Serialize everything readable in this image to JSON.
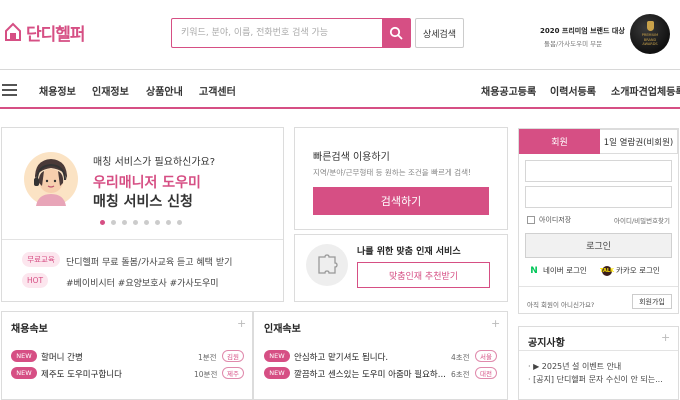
{
  "brand": {
    "name": "단디헬퍼",
    "accent": "#d64f84"
  },
  "search": {
    "placeholder": "키워드, 분야, 이름, 전화번호 검색 가능",
    "advanced_label": "상세검색"
  },
  "award": {
    "title": "2020 프리미엄 브랜드 대상",
    "subtitle": "돌봄/가사도우미 부문",
    "badge_lines": [
      "PREMIUM",
      "BRAND",
      "AWARDS"
    ]
  },
  "nav": {
    "left": [
      "채용정보",
      "인재정보",
      "상품안내",
      "고객센터"
    ],
    "right": [
      "채용공고등록",
      "이력서등록",
      "소개파견업체등록"
    ]
  },
  "banner": {
    "question": "매칭 서비스가 필요하신가요?",
    "title_pink": "우리매니저 도우미",
    "title_dark": "매칭 서비스 신청",
    "dots": 8,
    "active_dot": 0
  },
  "info": [
    {
      "tag": "무료교육",
      "text": "단디헬퍼 무료 돌봄/가사교육 듣고 혜택 받기"
    },
    {
      "tag": "HOT",
      "text": "#베이비시터 #요양보호사 #가사도우미"
    }
  ],
  "quick": {
    "title": "빠른검색 이용하기",
    "subtitle": "지역/분야/근무형태 등 원하는 조건을 빠르게 검색!",
    "button": "검색하기"
  },
  "match": {
    "title": "나를 위한 맞춤 인재 서비스",
    "button": "맞춤인재 추천받기"
  },
  "login": {
    "tab_member": "회원",
    "tab_guest": "1일 열람권(비회원)",
    "save_id": "아이디저장",
    "find": "아이디/비밀번호찾기",
    "login_button": "로그인",
    "naver": "네이버 로그인",
    "kakao": "카카오 로그인",
    "not_member": "아직 회원이 아니신가요?",
    "join": "회원가입"
  },
  "job_news": {
    "title": "채용속보",
    "rows": [
      {
        "badge": "NEW",
        "title": "할머니 간병",
        "time": "1분전",
        "loc": "김원"
      },
      {
        "badge": "NEW",
        "title": "제주도 도우미구합니다",
        "time": "10분전",
        "loc": "제주"
      }
    ]
  },
  "talent_news": {
    "title": "인재속보",
    "rows": [
      {
        "badge": "NEW",
        "title": "안심하고 맡기셔도 됩니다.",
        "time": "4초전",
        "loc": "서울"
      },
      {
        "badge": "NEW",
        "title": "깔끔하고 센스있는 도우미 아줌마 필요하...",
        "time": "6초전",
        "loc": "대전"
      }
    ]
  },
  "notice": {
    "title": "공지사항",
    "rows": [
      "· ▶ 2025년 설 이벤트 안내",
      "· [공지] 단디헬퍼 문자 수신이 안 되는..."
    ]
  }
}
